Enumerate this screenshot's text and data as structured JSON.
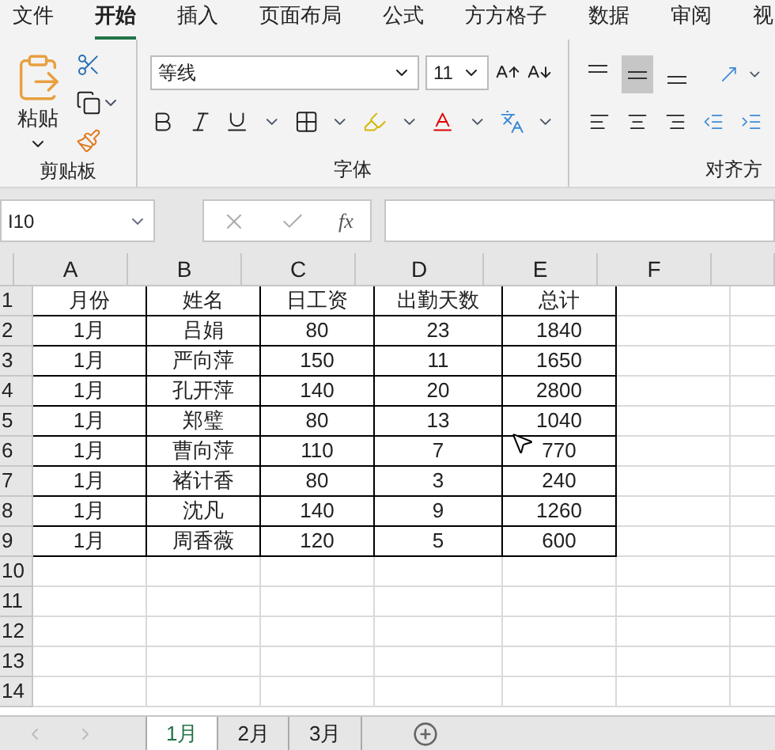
{
  "menu_tabs": [
    {
      "label": "文件",
      "selected": false
    },
    {
      "label": "开始",
      "selected": true
    },
    {
      "label": "插入",
      "selected": false
    },
    {
      "label": "页面布局",
      "selected": false
    },
    {
      "label": "公式",
      "selected": false
    },
    {
      "label": "方方格子",
      "selected": false
    },
    {
      "label": "数据",
      "selected": false
    },
    {
      "label": "审阅",
      "selected": false
    },
    {
      "label": "视",
      "selected": false
    }
  ],
  "ribbon": {
    "clipboard": {
      "paste_label": "粘贴",
      "group_label": "剪贴板"
    },
    "font": {
      "font_name": "等线",
      "font_size": "11",
      "group_label": "字体"
    },
    "alignment": {
      "vertical_align": [
        {
          "selected": false
        },
        {
          "selected": true
        },
        {
          "selected": false
        }
      ],
      "group_label": "对齐方"
    }
  },
  "formula_bar": {
    "name_box": "I10",
    "function_label": "fx"
  },
  "sheet": {
    "columns": [
      "A",
      "B",
      "C",
      "D",
      "E",
      "F"
    ],
    "rows": [
      {
        "number": "1",
        "cells": [
          "月份",
          "姓名",
          "日工资",
          "出勤天数",
          "总计"
        ]
      },
      {
        "number": "2",
        "cells": [
          "1月",
          "吕娟",
          "80",
          "23",
          "1840"
        ]
      },
      {
        "number": "3",
        "cells": [
          "1月",
          "严向萍",
          "150",
          "11",
          "1650"
        ]
      },
      {
        "number": "4",
        "cells": [
          "1月",
          "孔开萍",
          "140",
          "20",
          "2800"
        ]
      },
      {
        "number": "5",
        "cells": [
          "1月",
          "郑璧",
          "80",
          "13",
          "1040"
        ]
      },
      {
        "number": "6",
        "cells": [
          "1月",
          "曹向萍",
          "110",
          "7",
          "770"
        ]
      },
      {
        "number": "7",
        "cells": [
          "1月",
          "褚计香",
          "80",
          "3",
          "240"
        ]
      },
      {
        "number": "8",
        "cells": [
          "1月",
          "沈凡",
          "140",
          "9",
          "1260"
        ]
      },
      {
        "number": "9",
        "cells": [
          "1月",
          "周香薇",
          "120",
          "5",
          "600"
        ]
      },
      {
        "number": "10",
        "cells": []
      },
      {
        "number": "11",
        "cells": []
      },
      {
        "number": "12",
        "cells": []
      },
      {
        "number": "13",
        "cells": []
      },
      {
        "number": "14",
        "cells": []
      }
    ]
  },
  "sheet_tabs": [
    {
      "label": "1月",
      "selected": true
    },
    {
      "label": "2月",
      "selected": false
    },
    {
      "label": "3月",
      "selected": false
    }
  ]
}
